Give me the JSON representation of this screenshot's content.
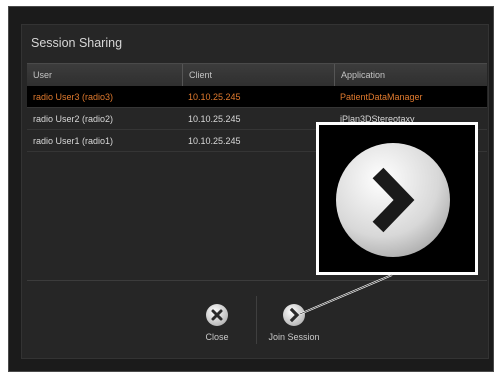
{
  "dialog": {
    "title": "Session Sharing"
  },
  "table": {
    "headers": [
      "User",
      "Client",
      "Application"
    ],
    "rows": [
      {
        "user": "radio User3 (radio3)",
        "client": "10.10.25.245",
        "application": "PatientDataManager",
        "selected": true
      },
      {
        "user": "radio User2 (radio2)",
        "client": "10.10.25.245",
        "application": "iPlan3DStereotaxy",
        "selected": false
      },
      {
        "user": "radio User1 (radio1)",
        "client": "10.10.25.245",
        "application": "",
        "selected": false
      }
    ]
  },
  "buttons": {
    "close_label": "Close",
    "join_label": "Join Session"
  },
  "icons": {
    "close": "close-x-icon",
    "join": "chevron-right-icon",
    "zoom": "chevron-right-icon"
  },
  "colors": {
    "selected_text": "#e07a2e",
    "background": "#262626",
    "highlight_border": "#ffffff"
  }
}
